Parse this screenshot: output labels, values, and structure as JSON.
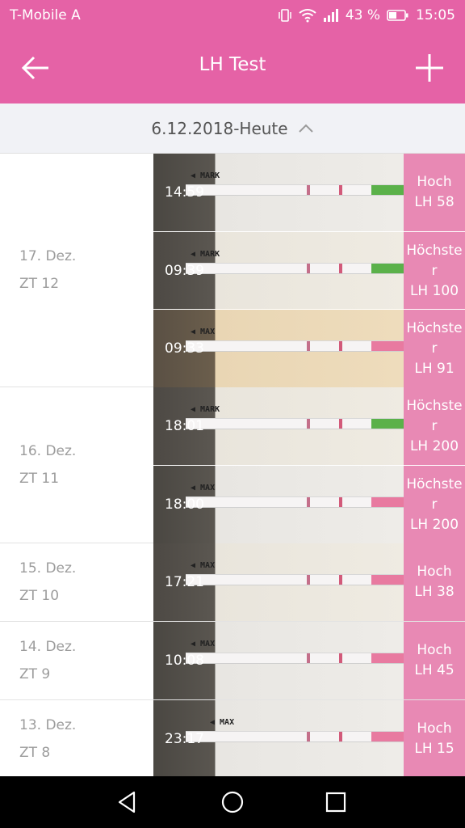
{
  "status": {
    "carrier": "T-Mobile A",
    "battery_pct": "43 %",
    "time": "15:05"
  },
  "appbar": {
    "title": "LH Test",
    "back_icon": "arrow-left-icon",
    "add_icon": "plus-icon"
  },
  "range": {
    "label": "6.12.2018-Heute",
    "icon": "chevron-up-icon"
  },
  "groups": [
    {
      "date": "17. Dez.",
      "cycle_day": "ZT 12",
      "entries": [
        {
          "time": "14:59",
          "level_label": "Hoch",
          "level_value": "LH 58"
        },
        {
          "time": "09:39",
          "level_label": "Höchster",
          "level_value": "LH 100"
        },
        {
          "time": "09:33",
          "level_label": "Höchster",
          "level_value": "LH 91"
        }
      ]
    },
    {
      "date": "16. Dez.",
      "cycle_day": "ZT 11",
      "entries": [
        {
          "time": "18:01",
          "level_label": "Höchster",
          "level_value": "LH 200"
        },
        {
          "time": "18:00",
          "level_label": "Höchster",
          "level_value": "LH 200"
        }
      ]
    },
    {
      "date": "15. Dez.",
      "cycle_day": "ZT 10",
      "entries": [
        {
          "time": "17:21",
          "level_label": "Hoch",
          "level_value": "LH 38"
        }
      ]
    },
    {
      "date": "14. Dez.",
      "cycle_day": "ZT 9",
      "entries": [
        {
          "time": "10:08",
          "level_label": "Hoch",
          "level_value": "LH 45"
        }
      ]
    },
    {
      "date": "13. Dez.",
      "cycle_day": "ZT 8",
      "entries": [
        {
          "time": "23:17",
          "level_label": "Hoch",
          "level_value": "LH 15"
        }
      ]
    }
  ],
  "colors": {
    "accent": "#e562a6",
    "level_badge": "#e889b4"
  },
  "navbar": {
    "back_icon": "triangle-back-icon",
    "home_icon": "circle-home-icon",
    "recents_icon": "square-recents-icon"
  }
}
